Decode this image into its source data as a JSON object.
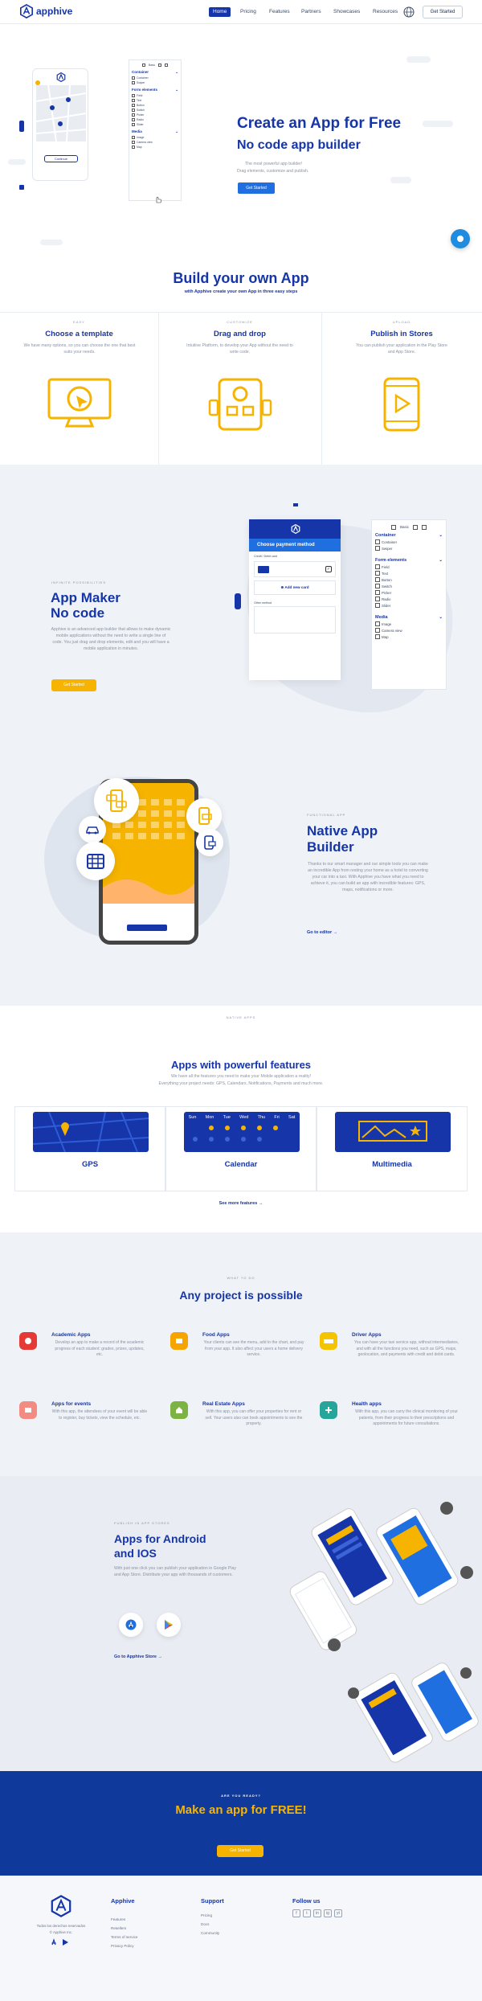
{
  "nav": {
    "brand": "apphive",
    "items": [
      "Home",
      "Pricing",
      "Features",
      "Partners",
      "Showcases",
      "Resources"
    ],
    "cta": "Get Started"
  },
  "hero": {
    "title": "Create an App for Free",
    "subtitle": "No code app builder",
    "line1": "The most powerful app builder!",
    "line2": "Drag elements, customize and publish.",
    "cta": "Get Started",
    "panel": {
      "tabs": [
        "Basic"
      ],
      "container_head": "Container",
      "container_items": [
        "Container",
        "Swiper"
      ],
      "form_head": "Form elements",
      "form_items": [
        "Field",
        "Text",
        "Button",
        "Switch",
        "Picker",
        "Radio",
        "Slider"
      ],
      "media_head": "Media",
      "media_items": [
        "Image",
        "Camera view",
        "Map"
      ],
      "phone_button": "Continue"
    }
  },
  "build": {
    "title": "Build your own App",
    "subtitle": "with Apphive create your own App in three easy steps",
    "steps": [
      {
        "hint": "EASY",
        "title": "Choose a template",
        "text": "We have many options, so you can choose the one that best suits your needs."
      },
      {
        "hint": "CUSTOMIZE",
        "title": "Drag and drop",
        "text": "Intuitive Platform, to develop your App without the need to write code."
      },
      {
        "hint": "UPLOAD",
        "title": "Publish in Stores",
        "text": "You can publish your application in the Play Store and App Store."
      }
    ]
  },
  "appmaker": {
    "hint": "INFINITE POSSIBILITIES",
    "title1": "App Maker",
    "title2": "No code",
    "text": "Apphive is an advanced app builder that allows to make dynamic mobile applications without the need to write a single line of code. You just drag and drop elements, edit and you will have a mobile application in minutes.",
    "cta": "Get Started",
    "screen_title": "Choose payment method",
    "screen_card_label": "Credit / Debit card",
    "screen_add": "Add new card",
    "screen_other": "Other method",
    "panel": {
      "tab": "Basic",
      "container_head": "Container",
      "container_items": [
        "Container",
        "Swiper"
      ],
      "form_head": "Form elements",
      "form_items": [
        "Field",
        "Text",
        "Button",
        "Switch",
        "Picker",
        "Radio",
        "Slider"
      ],
      "media_head": "Media",
      "media_items": [
        "Image",
        "Camera view",
        "Map"
      ]
    }
  },
  "native": {
    "hint": "FUNCTIONAL APP",
    "title1": "Native App",
    "title2": "Builder",
    "text": "Thanks to our smart manager and our simple tools you can make an incredible App from resting your home as a hotel to converting your car into a taxi. With Apphive you have what you need to achieve it, you can build an app with incredible features: GPS, maps, notifications or more.",
    "link": "Go to editor →"
  },
  "features": {
    "hint": "NATIVE APPS",
    "title": "Apps with powerful features",
    "line1": "We have all the features you need to make your Mobile application a reality!",
    "line2": "Everything your project needs: GPS, Calendars, Notifications, Payments and much more.",
    "cards": [
      "GPS",
      "Calendar",
      "Multimedia"
    ],
    "calendar_days": [
      "Sun",
      "Mon",
      "Tue",
      "Wed",
      "Thu",
      "Fri",
      "Sat"
    ],
    "link": "See more features →"
  },
  "projects": {
    "hint": "WHAT TO DO",
    "title": "Any project is possible",
    "items": [
      {
        "title": "Academic Apps",
        "text": "Develop an app to make a record of the academic progress of each student: grades, prizes, updates, etc.",
        "color": "#e53935"
      },
      {
        "title": "Food Apps",
        "text": "Your clients can see the menu, add to the chart, and pay from your app. It also affect your users a home delivery service.",
        "color": "#f6a400"
      },
      {
        "title": "Driver Apps",
        "text": "You can have your taxi service app, without intermediaries, and with all the functions you need, such as GPS, maps, geolocation, and payments with credit and debit cards.",
        "color": "#f4c400"
      },
      {
        "title": "Apps for events",
        "text": "With this app, the attendees of your event will be able to register, buy tickets, view the schedule, etc.",
        "color": "#f28b82"
      },
      {
        "title": "Real Estate Apps",
        "text": "With this app, you can offer your properties for rent or sell. Your users also can book appointments to see the property.",
        "color": "#7cb342"
      },
      {
        "title": "Health apps",
        "text": "With this app, you can carry the clinical monitoring of your patients, from their progress to their prescriptions and appointments for future consultations.",
        "color": "#26a69a"
      }
    ]
  },
  "stores": {
    "hint": "PUBLISH IN APP STORES",
    "title1": "Apps for Android",
    "title2": "and IOS",
    "text": "With just one click you can publish your application in Google Play and App Store. Distribute your app with thousands of customers.",
    "link": "Go to Apphive Store →"
  },
  "cta": {
    "hint": "ARE YOU READY?",
    "title": "Make an app for FREE!",
    "button": "Get Started"
  },
  "footer": {
    "tagline": "Todos los derechos reservados",
    "copy": "© Apphive Inc.",
    "col1_head": "Apphive",
    "col1": [
      "Features",
      "Resellers",
      "Terms of service",
      "Privacy Policy"
    ],
    "col2_head": "Support",
    "col2": [
      "Pricing",
      "Docs",
      "Community"
    ],
    "col3_head": "Follow us",
    "social": [
      "f",
      "t",
      "in",
      "ig",
      "yt"
    ]
  }
}
